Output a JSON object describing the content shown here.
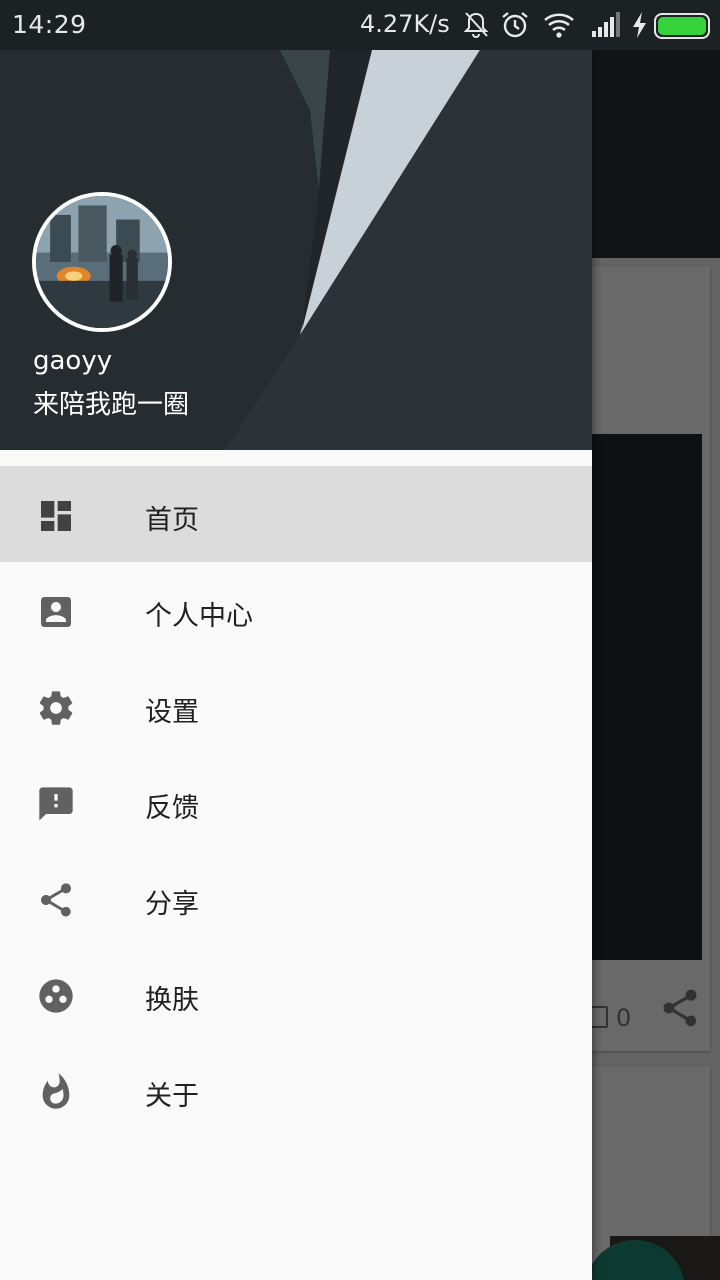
{
  "status_bar": {
    "time": "14:29",
    "network_speed": "4.27K/s",
    "icons": [
      "mute-bell-icon",
      "alarm-icon",
      "wifi-icon",
      "signal-icon",
      "charging-icon",
      "battery-icon"
    ],
    "battery_color": "#35d23b"
  },
  "drawer": {
    "header": {
      "username": "gaoyy",
      "signature": "来陪我跑一圈",
      "background_color": "#2a3237"
    },
    "menu": [
      {
        "label": "首页",
        "icon": "dashboard-icon",
        "active": true
      },
      {
        "label": "个人中心",
        "icon": "account-box-icon",
        "active": false
      },
      {
        "label": "设置",
        "icon": "gear-icon",
        "active": false
      },
      {
        "label": "反馈",
        "icon": "feedback-icon",
        "active": false
      },
      {
        "label": "分享",
        "icon": "share-icon",
        "active": false
      },
      {
        "label": "换肤",
        "icon": "palette-icon",
        "active": false
      },
      {
        "label": "关于",
        "icon": "flame-icon",
        "active": false
      }
    ],
    "icon_color": "#616161",
    "active_color": "#dcdcdc"
  },
  "background_content": {
    "comment_count": "0"
  }
}
